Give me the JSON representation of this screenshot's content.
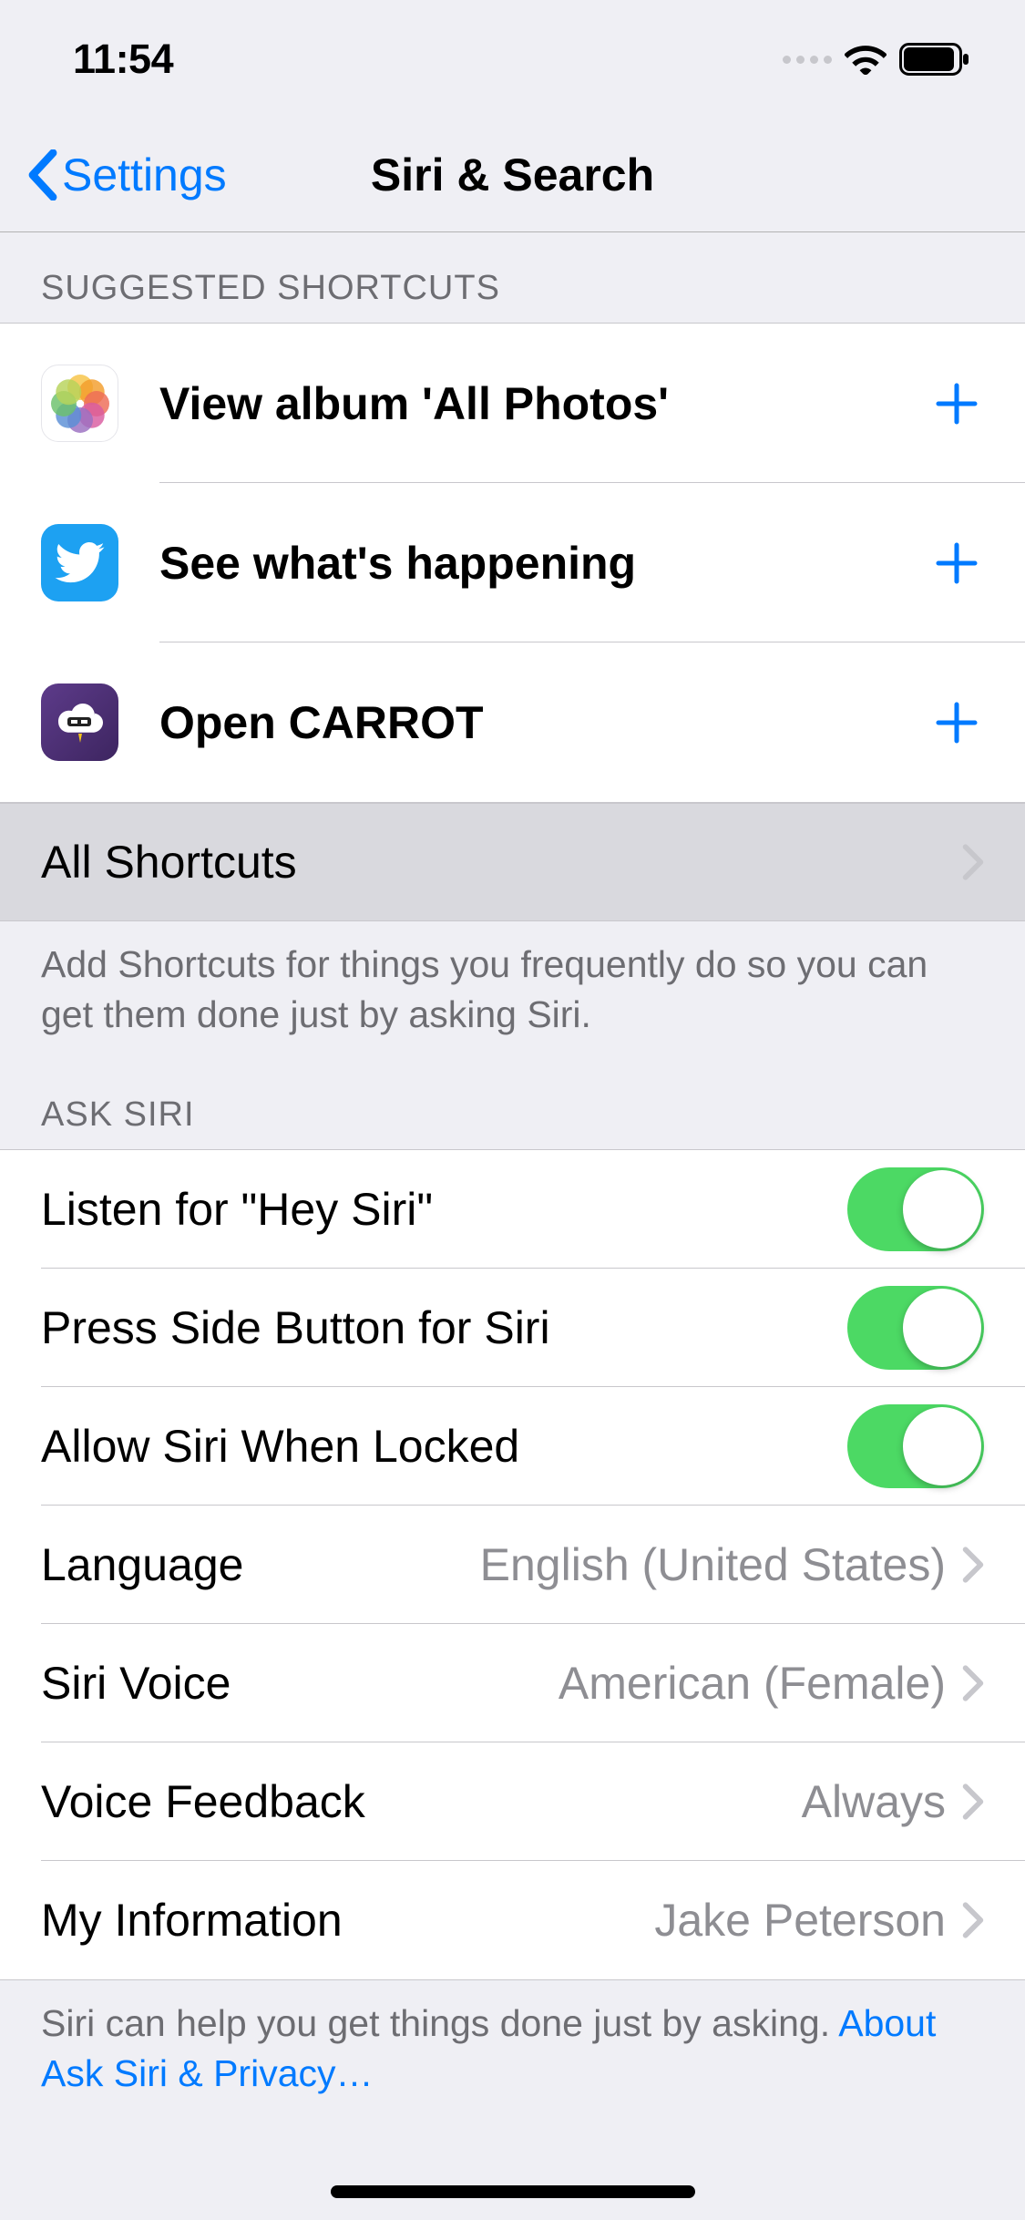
{
  "status": {
    "time": "11:54"
  },
  "nav": {
    "back": "Settings",
    "title": "Siri & Search"
  },
  "shortcuts": {
    "header": "SUGGESTED SHORTCUTS",
    "items": [
      {
        "label": "View album 'All Photos'"
      },
      {
        "label": "See what's happening"
      },
      {
        "label": "Open CARROT"
      }
    ],
    "all": "All Shortcuts",
    "footer": "Add Shortcuts for things you frequently do so you can get them done just by asking Siri."
  },
  "ask_siri": {
    "header": "ASK SIRI",
    "listen": {
      "label": "Listen for \"Hey Siri\"",
      "on": true
    },
    "side_button": {
      "label": "Press Side Button for Siri",
      "on": true
    },
    "locked": {
      "label": "Allow Siri When Locked",
      "on": true
    },
    "language": {
      "label": "Language",
      "value": "English (United States)"
    },
    "voice": {
      "label": "Siri Voice",
      "value": "American (Female)"
    },
    "feedback": {
      "label": "Voice Feedback",
      "value": "Always"
    },
    "my_info": {
      "label": "My Information",
      "value": "Jake Peterson"
    },
    "footer_text": "Siri can help you get things done just by asking. ",
    "footer_link": "About Ask Siri & Privacy…"
  }
}
